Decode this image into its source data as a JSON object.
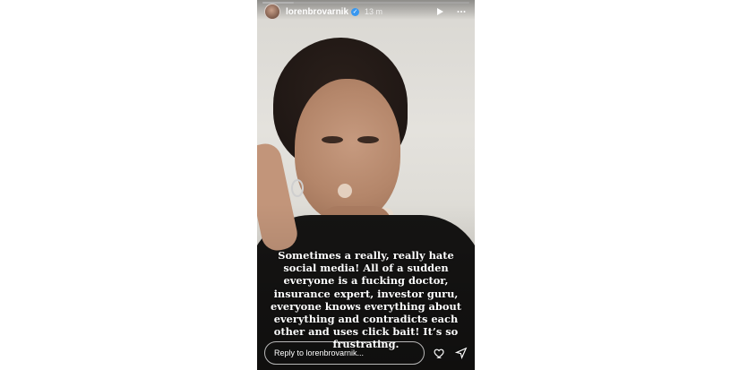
{
  "story": {
    "username": "lorenbrovarnik",
    "verified_icon": "verified-badge-icon",
    "time_ago": "13 m",
    "progress": 0.15,
    "caption": "Sometimes a really, really hate social media! All of a sudden everyone is a fucking doctor, insurance expert, investor guru, everyone knows everything about everything and contradicts each other and uses click bait! It’s so frustrating.",
    "reply_placeholder": "Reply to lorenbrovarnik...",
    "icons": {
      "play": "play-icon",
      "more": "more-options-icon",
      "like": "heart-icon",
      "share": "send-icon"
    }
  }
}
